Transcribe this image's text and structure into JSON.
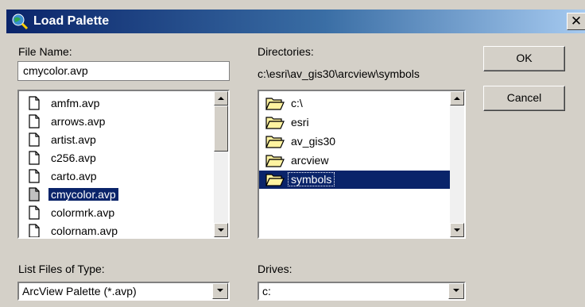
{
  "window": {
    "title": "Load Palette"
  },
  "file_name": {
    "label": "File Name:",
    "value": "cmycolor.avp"
  },
  "files": [
    {
      "name": "amfm.avp",
      "selected": false
    },
    {
      "name": "arrows.avp",
      "selected": false
    },
    {
      "name": "artist.avp",
      "selected": false
    },
    {
      "name": "c256.avp",
      "selected": false
    },
    {
      "name": "carto.avp",
      "selected": false
    },
    {
      "name": "cmycolor.avp",
      "selected": true
    },
    {
      "name": "colormrk.avp",
      "selected": false
    },
    {
      "name": "colornam.avp",
      "selected": false
    }
  ],
  "directories": {
    "label": "Directories:",
    "path": "c:\\esri\\av_gis30\\arcview\\symbols",
    "items": [
      {
        "name": "c:\\",
        "selected": false
      },
      {
        "name": "esri",
        "selected": false
      },
      {
        "name": "av_gis30",
        "selected": false
      },
      {
        "name": "arcview",
        "selected": false
      },
      {
        "name": "symbols",
        "selected": true
      }
    ]
  },
  "buttons": {
    "ok": "OK",
    "cancel": "Cancel"
  },
  "file_type": {
    "label": "List Files of Type:",
    "value": "ArcView Palette (*.avp)"
  },
  "drives": {
    "label": "Drives:",
    "value": "c:"
  },
  "colors": {
    "titlebar": "#0a246a",
    "selection": "#0a246a",
    "face": "#d4d0c8"
  }
}
